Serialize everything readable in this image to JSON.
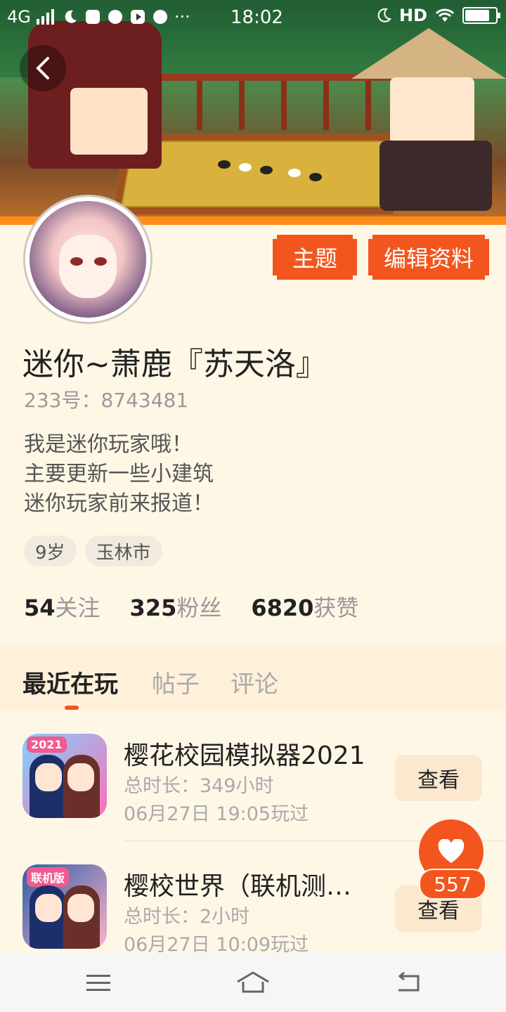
{
  "status_bar": {
    "network": "4G",
    "time": "18:02",
    "hd": "HD",
    "more": "···"
  },
  "profile": {
    "name": "迷你~萧鹿『苏天洛』",
    "uid": "233号：8743481",
    "bio": [
      "我是迷你玩家哦！",
      "主要更新一些小建筑",
      "迷你玩家前来报道！"
    ],
    "tags": [
      "9岁",
      "玉林市"
    ],
    "stats": [
      {
        "value": "54",
        "label": "关注"
      },
      {
        "value": "325",
        "label": "粉丝"
      },
      {
        "value": "6820",
        "label": "获赞"
      }
    ]
  },
  "buttons": {
    "theme": "主题",
    "edit_profile": "编辑资料"
  },
  "tabs": [
    {
      "label": "最近在玩",
      "active": true
    },
    {
      "label": "帖子",
      "active": false
    },
    {
      "label": "评论",
      "active": false
    }
  ],
  "recent_games": [
    {
      "title": "樱花校园模拟器2021",
      "duration": "总时长：349小时",
      "last_played": "06月27日 19:05玩过",
      "action": "查看",
      "icon_badge": "2021"
    },
    {
      "title": "樱校世界（联机测…",
      "duration": "总时长：2小时",
      "last_played": "06月27日 10:09玩过",
      "action": "查看",
      "icon_badge": "联机版"
    }
  ],
  "like": {
    "count": "557",
    "icon": "heart-icon"
  },
  "colors": {
    "accent": "#f2561e",
    "background": "#fff7e6",
    "tab_bar": "#fff0da"
  }
}
